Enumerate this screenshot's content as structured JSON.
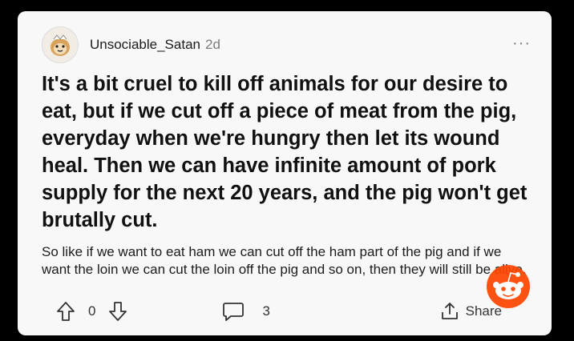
{
  "post": {
    "username": "Unsociable_Satan",
    "age": "2d",
    "more_label": "···",
    "title": "It's a bit cruel to kill off animals for our desire to eat, but if we cut off a piece of meat from the pig, everyday when we're hungry then let its wound heal. Then we can have infinite amount of pork supply for the next 20 years, and the pig won't get brutally cut.",
    "body": "So like if we want to eat ham we can cut off the ham part of the pig and if we want the loin we can cut the loin off the pig and so on, then they will still be alive."
  },
  "actions": {
    "vote_count": "0",
    "comment_count": "3",
    "share_label": "Share"
  },
  "icons": {
    "avatar": "user-avatar-icon",
    "upvote": "upvote-arrow-icon",
    "downvote": "downvote-arrow-icon",
    "comment": "comment-bubble-icon",
    "share": "share-icon",
    "watermark": "reddit-snoo-logo"
  },
  "colors": {
    "card_background": "#f8f8f8",
    "page_background": "#000000",
    "text": "#111111",
    "muted": "#7c7c7c",
    "snoo_orange": "#ff4500"
  }
}
